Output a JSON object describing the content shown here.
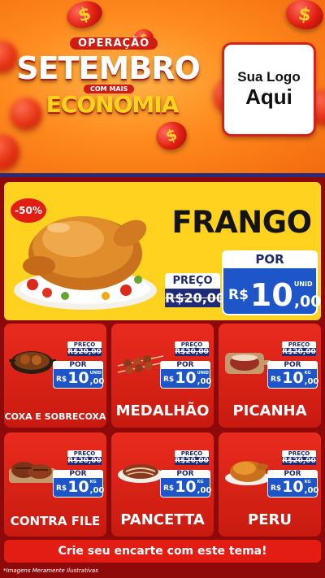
{
  "header": {
    "campaign_top": "OPERAÇÃO",
    "campaign_main": "SETEMBRO",
    "campaign_mid": "COM MAIS",
    "campaign_bottom": "ECONOMIA",
    "coin_symbol": "$",
    "logo_line1": "Sua Logo",
    "logo_line2": "Aqui"
  },
  "hero": {
    "discount_badge": "-50%",
    "product_name": "FRANGO",
    "preco_label": "PREÇO",
    "old_price": "R$20,00",
    "por_label": "POR",
    "currency": "R$",
    "new_price_int": "10",
    "new_price_dec": ",00",
    "unit": "UNID"
  },
  "products": [
    {
      "name": "COXA E SOBRECOXA",
      "preco_label": "PREÇO",
      "old_price": "R$20,00",
      "por_label": "POR",
      "currency": "R$",
      "price_int": "10",
      "price_dec": ",00",
      "unit": "UNID"
    },
    {
      "name": "MEDALHÃO",
      "preco_label": "PREÇO",
      "old_price": "R$20,00",
      "por_label": "POR",
      "currency": "R$",
      "price_int": "10",
      "price_dec": ",00",
      "unit": "UNID"
    },
    {
      "name": "PICANHA",
      "preco_label": "PREÇO",
      "old_price": "R$20,00",
      "por_label": "POR",
      "currency": "R$",
      "price_int": "10",
      "price_dec": ",00",
      "unit": "KG"
    },
    {
      "name": "CONTRA FILE",
      "preco_label": "PREÇO",
      "old_price": "R$20,00",
      "por_label": "POR",
      "currency": "R$",
      "price_int": "10",
      "price_dec": ",00",
      "unit": "KG"
    },
    {
      "name": "PANCETTA",
      "preco_label": "PREÇO",
      "old_price": "R$20,00",
      "por_label": "POR",
      "currency": "R$",
      "price_int": "10",
      "price_dec": ",00",
      "unit": "KG"
    },
    {
      "name": "PERU",
      "preco_label": "PREÇO",
      "old_price": "R$20,00",
      "por_label": "POR",
      "currency": "R$",
      "price_int": "10",
      "price_dec": ",00",
      "unit": "KG"
    }
  ],
  "footer": {
    "cta": "Crie seu encarte com este tema!",
    "disclaimer": "*Imagens Meramente Ilustrativas"
  },
  "colors": {
    "red": "#e31d13",
    "yellow": "#ffd21f",
    "blue": "#1e55c8",
    "navy": "#1f2a79",
    "orange": "#ff8a1e"
  }
}
